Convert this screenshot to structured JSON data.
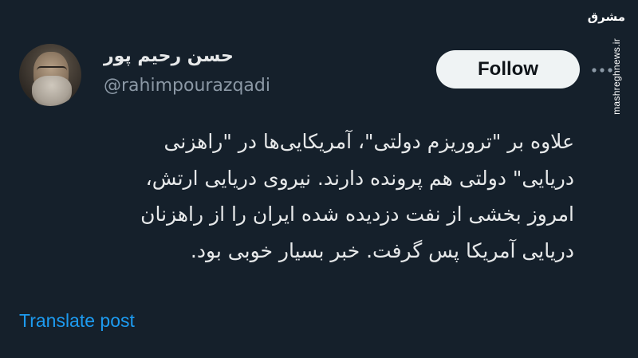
{
  "tweet": {
    "author": {
      "display_name": "حسن رحیم پور",
      "handle": "@rahimpourazqadi"
    },
    "follow_label": "Follow",
    "more_icon": "more-horizontal-icon",
    "text_lines": [
      "علاوه بر \"تروریزم دولتی\"، آمریکایی‌ها در \"راهزنی",
      "دریایی\" دولتی هم پرونده دارند.  نیروی دریایی ارتش،",
      "امروز بخشی از نفت دزدیده شده ایران را از راهزنان",
      "دریایی آمریکا پس گرفت. خبر بسیار خوبی بود."
    ],
    "translate_label": "Translate post"
  },
  "watermark": {
    "logo": "مشرق",
    "url": "mashreghnews.ir"
  },
  "colors": {
    "background": "#15202b",
    "text": "#e7e9ea",
    "muted": "#8b98a5",
    "link": "#1d9bf0",
    "button_bg": "#eff3f4"
  }
}
